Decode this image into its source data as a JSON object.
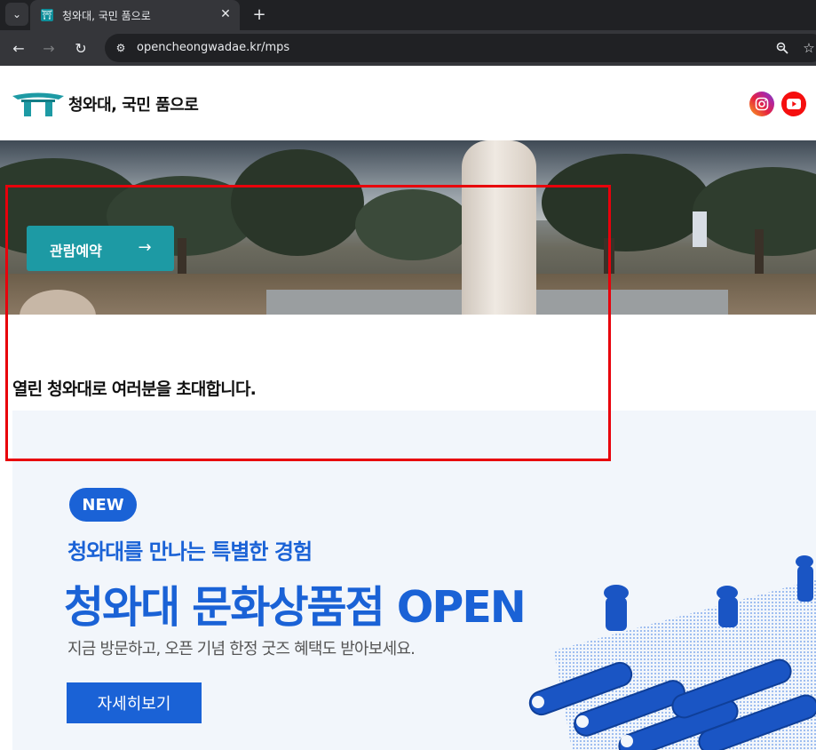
{
  "browser": {
    "tab": {
      "title": "청와대, 국민 품으로"
    },
    "url": "opencheongwadae.kr/mps",
    "icons": [
      "tab-search-icon",
      "favicon-icon",
      "close-icon",
      "plus-icon",
      "back-icon",
      "forward-icon",
      "reload-icon",
      "site-info-icon",
      "zoom-icon",
      "star-icon"
    ]
  },
  "header": {
    "logo_text": "청와대, 국민 품으로",
    "social": [
      "instagram-icon",
      "youtube-icon"
    ]
  },
  "hero": {
    "reserve_label": "관람예약",
    "reserve_arrow": "→"
  },
  "invite": {
    "text": "열린 청와대로 여러분을 초대합니다."
  },
  "banner": {
    "badge": "NEW",
    "sub_title": "청와대를 만나는 특별한 경험",
    "main_title": "청와대 문화상품점 OPEN",
    "description": "지금 방문하고, 오픈 기념 한정 굿즈 혜택도 받아보세요.",
    "button_label": "자세히보기"
  },
  "colors": {
    "brand_teal": "#1d9aa4",
    "banner_blue": "#1a62d6",
    "highlight_red": "#e8000b"
  }
}
